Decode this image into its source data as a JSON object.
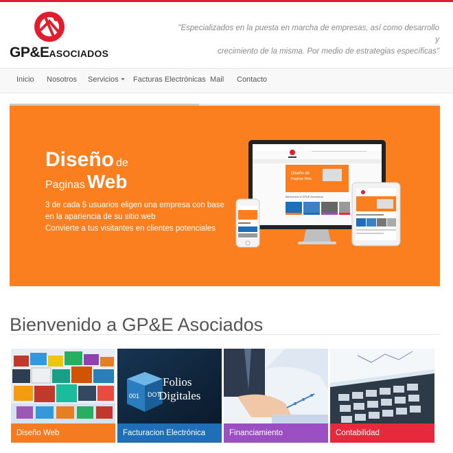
{
  "header": {
    "logo_text_main": "GP&E",
    "logo_text_sub": "ASOCIADOS",
    "tagline_line1": "\"Especializados en la puesta en marcha de empresas, así como desarrollo y",
    "tagline_line2": "crecimiento de la misma. Por medio de estrategias específicas\""
  },
  "nav": {
    "items": [
      "Inicio",
      "Nosotros",
      "Servicios",
      "Facturas Electrónicas",
      "Mail",
      "Contacto"
    ]
  },
  "slider": {
    "progress": 0.44,
    "title_bold": "Diseño",
    "title_small": "de",
    "title2_small": "Paginas",
    "title2_bold": "Web",
    "line1": "3 de cada 5 usuarios eligen una empresa con base",
    "line2": "en la apariencia de su sitio web",
    "line3": "Convierte a tus visitantes en clientes potenciales",
    "screen_title_a": "Diseño de",
    "screen_title_b": "Paginas Web",
    "screen_caption": "Bienvenido a GP&E Asociados",
    "brand_color": "#fb7f1e"
  },
  "main": {
    "headline": "Bienvenido a GP&E Asociados",
    "tiles": [
      {
        "label": "Diseño Web",
        "color": "#f47b20"
      },
      {
        "label": "Facturacion Electrónica",
        "color": "#1e6fb8",
        "image_text_1": "Folios",
        "image_text_2": "Digitales",
        "cube_text_1": "001",
        "cube_text_2": "DOT"
      },
      {
        "label": "Financiamiento",
        "color": "#9b4fc2"
      },
      {
        "label": "Contabilidad",
        "color": "#e8283c"
      }
    ]
  }
}
